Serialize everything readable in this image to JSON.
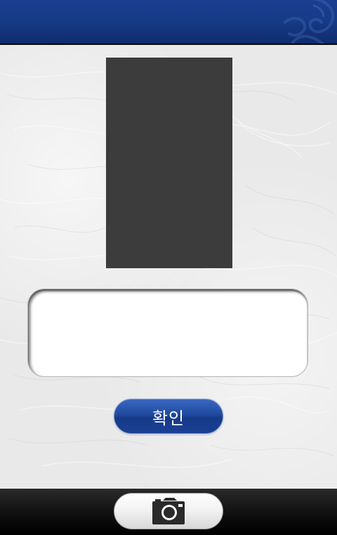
{
  "header": {
    "ornament_icon": "dragon-ornament-icon"
  },
  "main": {
    "photo_preview_icon": "photo-placeholder",
    "result_box": {
      "value": "",
      "placeholder": ""
    },
    "confirm_button": {
      "label": "확인"
    }
  },
  "footer": {
    "camera_button_icon": "camera-icon"
  },
  "colors": {
    "header_blue": "#173a86",
    "button_blue": "#1f4aa0",
    "photo_dark": "#3c3c3c",
    "background": "#e9e9e9",
    "footer_black": "#0d0d0d"
  }
}
